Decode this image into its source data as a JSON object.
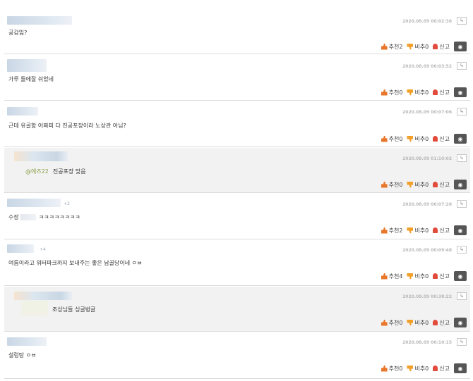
{
  "comments": [
    {
      "level": "",
      "time": "2020.08.09 00:02:36",
      "text": "공감임?",
      "mention": "",
      "up": "추천2",
      "down": "비추0",
      "report": "신고"
    },
    {
      "level": "",
      "time": "2020.08.09 00:03:52",
      "text": "가루 들에잘 쉬었네",
      "mention": "",
      "up": "추천0",
      "down": "비추0",
      "report": "신고"
    },
    {
      "level": "",
      "time": "2020.08.09 00:07:06",
      "text": "근데 유골함 어짜피 다 진공포장이라 노상관 아님?",
      "mention": "",
      "up": "추천0",
      "down": "비추0",
      "report": "신고"
    },
    {
      "level": "",
      "time": "2020.08.09 01:10:02",
      "text": "진공포장 맞음",
      "mention": "@에즈22",
      "up": "추천0",
      "down": "비추0",
      "report": "신고"
    },
    {
      "level": "+2",
      "time": "2020.08.09 00:07:28",
      "text": "ㅋㅋㅋㅋㅋㅋㅋㅋ",
      "prefix": "수장",
      "mention": "",
      "up": "추천2",
      "down": "비추0",
      "report": "신고"
    },
    {
      "level": "+4",
      "time": "2020.08.09 00:09:48",
      "text": "여름이라고 워터파크까지 보내주는 좋은 납골당이네 ㅇㅂ",
      "mention": "",
      "up": "추천4",
      "down": "비추0",
      "report": "신고"
    },
    {
      "level": "",
      "time": "2020.08.09 00:38:22",
      "text": "조상님들 싱글벙글",
      "mention": "",
      "up": "추천0",
      "down": "비추0",
      "report": "신고"
    },
    {
      "level": "",
      "time": "2020.08.09 00:10:15",
      "text": "설렁탕 ㅇㅂ",
      "mention": "",
      "up": "추천0",
      "down": "비추0",
      "report": "신고"
    }
  ],
  "icons": {
    "up": "thumbs-up-icon",
    "down": "thumbs-down-icon",
    "report": "siren-icon",
    "hide": "eye-hide-icon",
    "reply": "reply-arrow-icon"
  },
  "colors": {
    "reply_bg": "#f2f2f2",
    "mention": "#8aa04a",
    "hide_btn": "#555555"
  }
}
